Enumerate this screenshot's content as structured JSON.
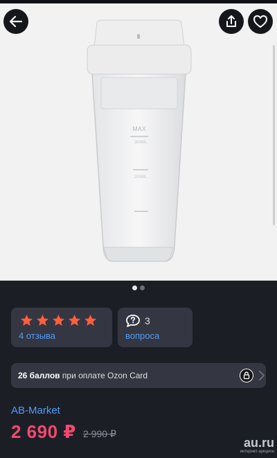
{
  "product": {
    "images_count": 2,
    "active_image": 1,
    "cup_markings": [
      "MAX",
      "300ML",
      "200ML"
    ]
  },
  "rating": {
    "stars": 5,
    "max": 5,
    "reviews_label": "4 отзыва",
    "star_color": "#ff5f3c"
  },
  "questions": {
    "count": "3",
    "label": "вопроса"
  },
  "ozon_card": {
    "points": "26 баллов",
    "text": " при оплате Ozon Card"
  },
  "seller": {
    "name": "AB-Market"
  },
  "pricing": {
    "current": "2 690 ₽",
    "old": "2 990 ₽",
    "accent_color": "#f2496e"
  },
  "watermark": {
    "main": "au.ru",
    "sub": "интернет-аукцион"
  },
  "icons": {
    "back": "arrow-left-icon",
    "share": "share-icon",
    "favorite": "heart-icon",
    "questions": "question-bubble-icon",
    "lock": "lock-icon",
    "chevron": "chevron-right-icon"
  }
}
